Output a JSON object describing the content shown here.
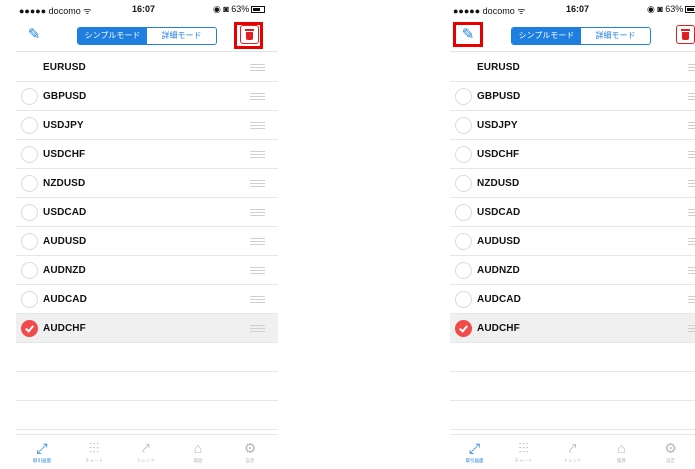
{
  "status_bar": {
    "carrier": "●●●●● docomo ᯤ",
    "time": "16:07",
    "battery": "◉ ◙ 63%"
  },
  "nav": {
    "edit_icon": "pencil-icon",
    "segments": [
      "シンプルモード",
      "詳細モード"
    ],
    "delete_icon": "trash-icon"
  },
  "symbols": [
    "EURUSD",
    "GBPUSD",
    "USDJPY",
    "USDCHF",
    "NZDUSD",
    "USDCAD",
    "AUDUSD",
    "AUDNZD",
    "AUDCAD",
    "AUDCHF"
  ],
  "selected_symbol": "AUDCHF",
  "tabs": [
    {
      "label": "取引画面",
      "icon": "trade-arrows-icon",
      "glyph": "⤢"
    },
    {
      "label": "チャート",
      "icon": "candlestick-icon",
      "glyph": "⫶⫶⫶"
    },
    {
      "label": "トレンド",
      "icon": "trend-icon",
      "glyph": "⤤"
    },
    {
      "label": "履歴",
      "icon": "inbox-icon",
      "glyph": "⌂"
    },
    {
      "label": "設定",
      "icon": "gear-icon",
      "glyph": "⚙"
    }
  ],
  "colors": {
    "accent": "#1e7fe0",
    "delete": "#e02020",
    "highlight": "#e80000",
    "checked": "#f04a4a"
  }
}
